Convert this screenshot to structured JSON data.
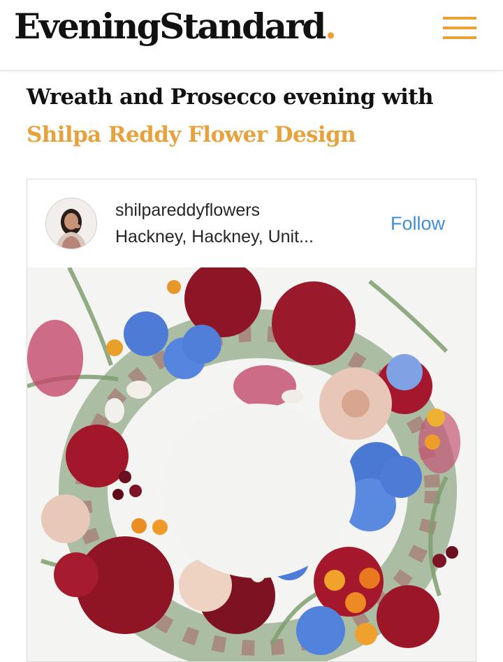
{
  "header": {
    "logo_text": "EveningStandard",
    "logo_dot": ".",
    "accent_color": "#e8a03a"
  },
  "article": {
    "title_line1": "Wreath and Prosecco  evening  with",
    "title_line2": "Shilpa Reddy Flower Design"
  },
  "instagram_embed": {
    "username": "shilpareddyflowers",
    "location": "Hackney, Hackney, Unit...",
    "follow_label": "Follow",
    "follow_color": "#3f8fd8"
  }
}
